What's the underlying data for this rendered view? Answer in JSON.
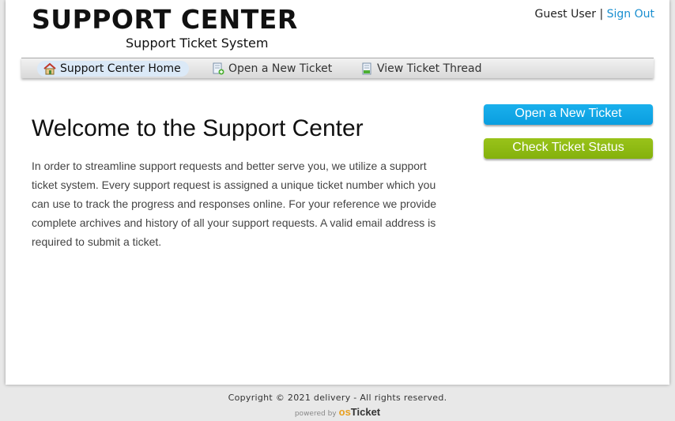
{
  "header": {
    "logo_title": "SUPPORT CENTER",
    "logo_subtitle": "Support Ticket System",
    "user_name": "Guest User",
    "separator": "|",
    "sign_out": "Sign Out"
  },
  "nav": {
    "items": [
      {
        "label": "Support Center Home",
        "icon": "home-icon",
        "active": true
      },
      {
        "label": "Open a New Ticket",
        "icon": "new-ticket-icon",
        "active": false
      },
      {
        "label": "View Ticket Thread",
        "icon": "ticket-thread-icon",
        "active": false
      }
    ]
  },
  "main": {
    "title": "Welcome to the Support Center",
    "body": "In order to streamline support requests and better serve you, we utilize a support ticket system. Every support request is assigned a unique ticket number which you can use to track the progress and responses online. For your reference we provide complete archives and history of all your support requests. A valid email address is required to submit a ticket."
  },
  "sidebar": {
    "open_ticket_label": "Open a New Ticket",
    "check_status_label": "Check Ticket Status"
  },
  "footer": {
    "copyright": "Copyright © 2021 delivery - All rights reserved.",
    "powered_by": "powered by",
    "brand_prefix": "os",
    "brand_suffix": "Ticket"
  },
  "colors": {
    "link": "#1a8fd0",
    "button_blue": "#0a9ee0",
    "button_green": "#84b10c"
  }
}
